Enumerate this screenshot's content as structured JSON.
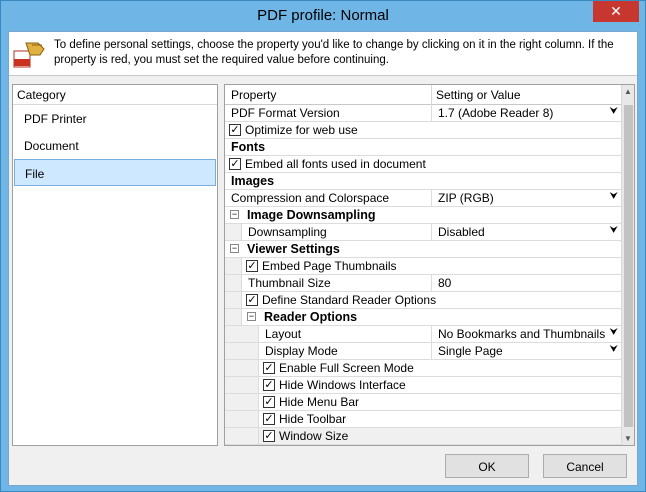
{
  "window": {
    "title": "PDF profile: Normal",
    "close_glyph": "✕"
  },
  "info": {
    "icon": "pdf-hand-icon",
    "text": "To define personal settings, choose the property you'd like to change by clicking on it in the right column. If the property is red, you must set the required value before continuing."
  },
  "category": {
    "header": "Category",
    "items": [
      "PDF Printer",
      "Document",
      "File"
    ],
    "selected": "File"
  },
  "properties": {
    "col_property": "Property",
    "col_value": "Setting or Value",
    "rows": [
      {
        "type": "value",
        "label": "PDF Format Version",
        "value": "1.7 (Adobe Reader 8)",
        "dropdown": true,
        "indent": 0
      },
      {
        "type": "check",
        "label": "Optimize for web use",
        "checked": true,
        "indent": 0
      },
      {
        "type": "section",
        "label": "Fonts",
        "indent": 0
      },
      {
        "type": "check",
        "label": "Embed all fonts used in document",
        "checked": true,
        "indent": 0
      },
      {
        "type": "section",
        "label": "Images",
        "indent": 0
      },
      {
        "type": "value",
        "label": "Compression and Colorspace",
        "value": "ZIP (RGB)",
        "dropdown": true,
        "indent": 0
      },
      {
        "type": "group",
        "label": "Image Downsampling",
        "indent": 0
      },
      {
        "type": "value",
        "label": "Downsampling",
        "value": "Disabled",
        "dropdown": true,
        "indent": 1
      },
      {
        "type": "group",
        "label": "Viewer Settings",
        "indent": 0
      },
      {
        "type": "check",
        "label": "Embed Page Thumbnails",
        "checked": true,
        "indent": 1
      },
      {
        "type": "value",
        "label": "Thumbnail Size",
        "value": "80",
        "dropdown": false,
        "indent": 1
      },
      {
        "type": "check",
        "label": "Define Standard Reader Options",
        "checked": true,
        "indent": 1
      },
      {
        "type": "group",
        "label": "Reader Options",
        "indent": 1
      },
      {
        "type": "value",
        "label": "Layout",
        "value": "No Bookmarks and Thumbnails",
        "dropdown": true,
        "indent": 2
      },
      {
        "type": "value",
        "label": "Display Mode",
        "value": "Single Page",
        "dropdown": true,
        "indent": 2
      },
      {
        "type": "check",
        "label": "Enable Full Screen Mode",
        "checked": true,
        "indent": 2
      },
      {
        "type": "check",
        "label": "Hide Windows Interface",
        "checked": true,
        "indent": 2
      },
      {
        "type": "check",
        "label": "Hide Menu Bar",
        "checked": true,
        "indent": 2
      },
      {
        "type": "check",
        "label": "Hide Toolbar",
        "checked": true,
        "indent": 2
      },
      {
        "type": "check",
        "label": "Window Size",
        "checked": true,
        "indent": 2,
        "selected": true
      }
    ]
  },
  "buttons": {
    "ok": "OK",
    "cancel": "Cancel"
  },
  "glyphs": {
    "dropdown": "⮟",
    "check": "✓",
    "minus": "−",
    "scroll_up": "▲",
    "scroll_down": "▼"
  }
}
